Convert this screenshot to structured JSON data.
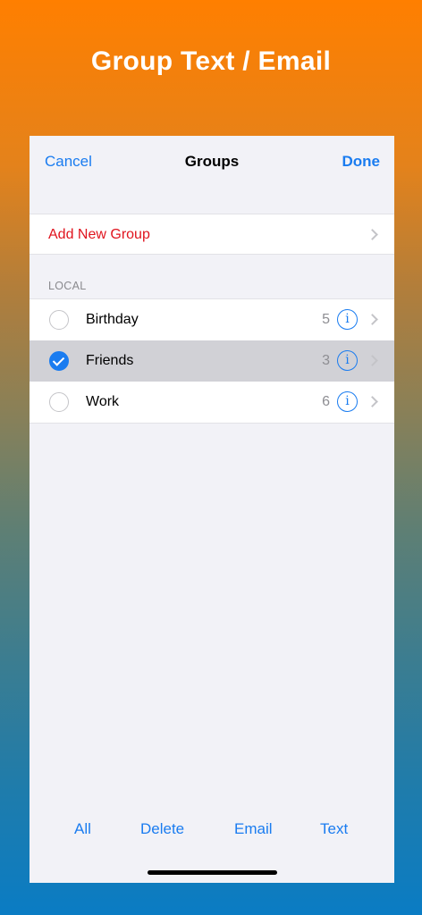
{
  "hero": {
    "title": "Group Text / Email"
  },
  "navbar": {
    "cancel": "Cancel",
    "title": "Groups",
    "done": "Done"
  },
  "add_group": {
    "label": "Add New Group"
  },
  "section": {
    "header": "LOCAL"
  },
  "groups": [
    {
      "name": "Birthday",
      "count": "5",
      "selected": false
    },
    {
      "name": "Friends",
      "count": "3",
      "selected": true
    },
    {
      "name": "Work",
      "count": "6",
      "selected": false
    }
  ],
  "info_glyph": "i",
  "toolbar": {
    "all": "All",
    "delete": "Delete",
    "email": "Email",
    "text": "Text"
  },
  "colors": {
    "accent": "#1a7cf0",
    "destructive": "#e0141e",
    "gradient_top": "#ff7f00",
    "gradient_bottom": "#0a7cc4"
  }
}
